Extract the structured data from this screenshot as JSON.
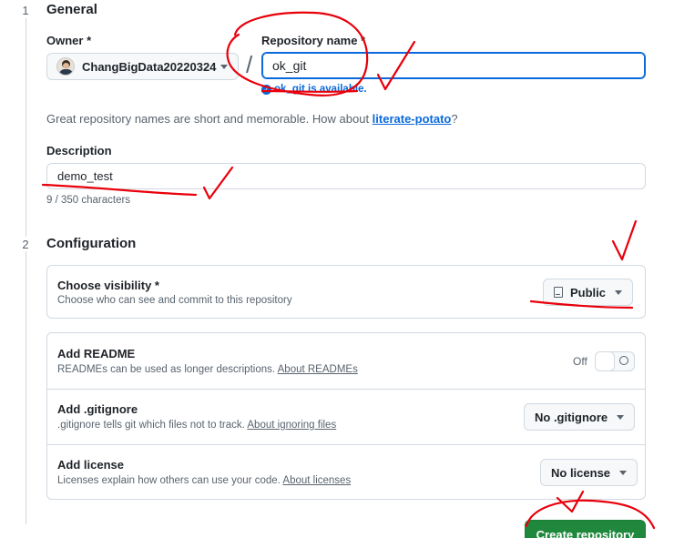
{
  "steps": [
    {
      "number": "1",
      "title": "General"
    },
    {
      "number": "2",
      "title": "Configuration"
    }
  ],
  "owner": {
    "label": "Owner *",
    "name": "ChangBigData20220324"
  },
  "repo": {
    "label": "Repository name *",
    "value": "ok_git",
    "availability": "ok_git is available."
  },
  "suggestion": {
    "text": "Great repository names are short and memorable. How about ",
    "name": "literate-potato",
    "suffix": "?"
  },
  "description": {
    "label": "Description",
    "value": "demo_test",
    "counter": "9 / 350 characters"
  },
  "visibility": {
    "title": "Choose visibility *",
    "desc": "Choose who can see and commit to this repository",
    "value": "Public"
  },
  "readme": {
    "title": "Add README",
    "desc": "READMEs can be used as longer descriptions. ",
    "link": "About READMEs",
    "toggle_state": "Off"
  },
  "gitignore": {
    "title": "Add .gitignore",
    "desc": ".gitignore tells git which files not to track. ",
    "link": "About ignoring files",
    "value": "No .gitignore"
  },
  "license": {
    "title": "Add license",
    "desc": "Licenses explain how others can use your code. ",
    "link": "About licenses",
    "value": "No license"
  },
  "create_button": "Create repository",
  "colors": {
    "primary": "#1f883d",
    "link": "#0969da",
    "annotation": "#e8000b"
  }
}
